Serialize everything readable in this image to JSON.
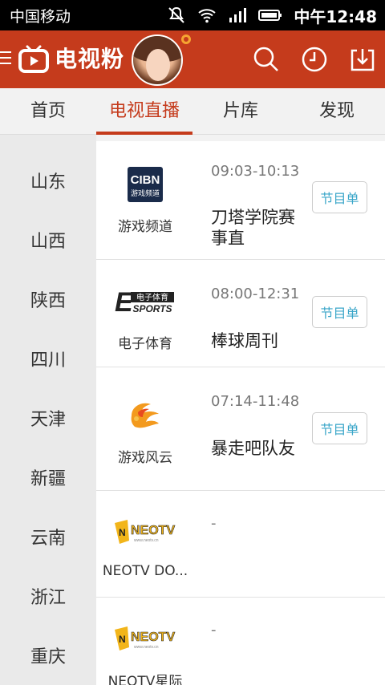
{
  "status_bar": {
    "carrier": "中国移动",
    "time": "中午12:48",
    "icons": [
      "mute-icon",
      "wifi-icon",
      "signal-icon",
      "battery-icon"
    ]
  },
  "header": {
    "app_name": "电视粉",
    "brand_color": "#c53b1c",
    "actions": [
      "search-icon",
      "history-icon",
      "download-icon"
    ]
  },
  "tabs": [
    {
      "label": "首页",
      "active": false
    },
    {
      "label": "电视直播",
      "active": true
    },
    {
      "label": "片库",
      "active": false
    },
    {
      "label": "发现",
      "active": false
    }
  ],
  "provinces": [
    "山东",
    "山西",
    "陕西",
    "四川",
    "天津",
    "新疆",
    "云南",
    "浙江",
    "重庆"
  ],
  "channels": [
    {
      "name": "游戏频道",
      "logo": "CIBN 游戏频道",
      "time": "09:03-10:13",
      "program": "刀塔学院赛事直",
      "button": "节目单"
    },
    {
      "name": "电子体育",
      "logo": "E 电子体育 SPORTS",
      "time": "08:00-12:31",
      "program": "棒球周刊",
      "button": "节目单"
    },
    {
      "name": "游戏风云",
      "logo": "游戏风云",
      "time": "07:14-11:48",
      "program": "暴走吧队友",
      "button": "节目单"
    },
    {
      "name": "NEOTV DO...",
      "logo": "NEOTV",
      "time": "-",
      "program": "",
      "button": ""
    },
    {
      "name": "NEOTV星际",
      "logo": "NEOTV",
      "time": "-",
      "program": "",
      "button": ""
    }
  ]
}
